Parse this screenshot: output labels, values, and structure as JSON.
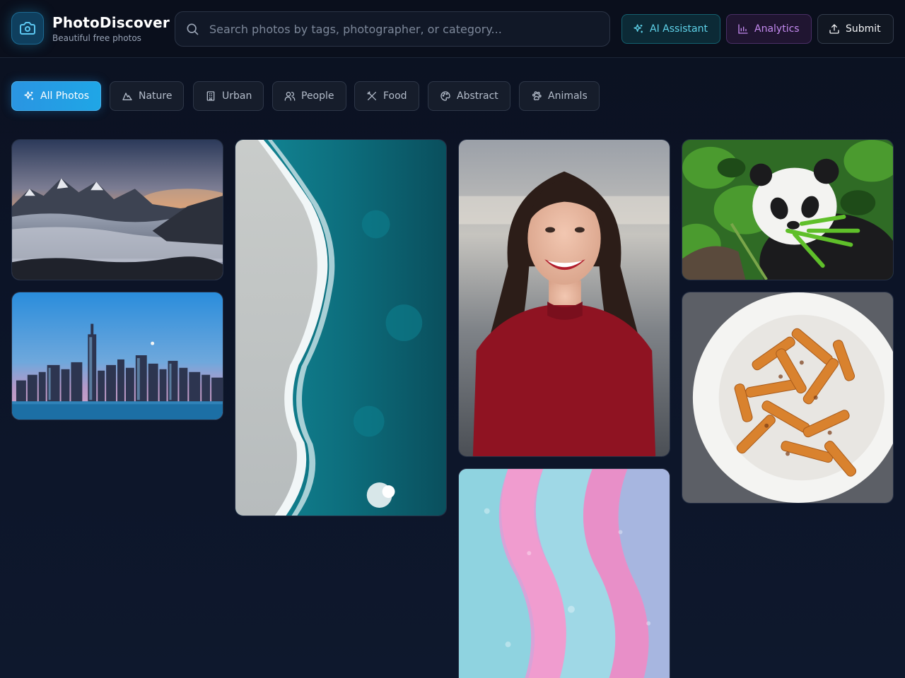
{
  "brand": {
    "name": "PhotoDiscover",
    "tagline": "Beautiful free photos",
    "icon": "camera-icon"
  },
  "search": {
    "placeholder": "Search photos by tags, photographer, or category...",
    "value": ""
  },
  "header_buttons": [
    {
      "label": "AI Assistant",
      "icon": "sparkles-icon"
    },
    {
      "label": "Analytics",
      "icon": "bar-chart-icon"
    },
    {
      "label": "Submit",
      "icon": "upload-icon"
    }
  ],
  "categories": [
    {
      "label": "All Photos",
      "icon": "sparkles-icon",
      "active": true
    },
    {
      "label": "Nature",
      "icon": "mountain-icon",
      "active": false
    },
    {
      "label": "Urban",
      "icon": "building-icon",
      "active": false
    },
    {
      "label": "People",
      "icon": "users-icon",
      "active": false
    },
    {
      "label": "Food",
      "icon": "utensils-icon",
      "active": false
    },
    {
      "label": "Abstract",
      "icon": "palette-icon",
      "active": false
    },
    {
      "label": "Animals",
      "icon": "paw-icon",
      "active": false
    }
  ],
  "photos": [
    {
      "subject": "mountain-sunset"
    },
    {
      "subject": "city-skyline"
    },
    {
      "subject": "ocean-shoreline"
    },
    {
      "subject": "smiling-woman"
    },
    {
      "subject": "abstract-fluid"
    },
    {
      "subject": "panda-bamboo"
    },
    {
      "subject": "pasta-plate"
    }
  ],
  "colors": {
    "accent": "#22a3e6",
    "ai": "#5fd3ea",
    "analytics": "#c48af0",
    "background": "#0b1120"
  }
}
